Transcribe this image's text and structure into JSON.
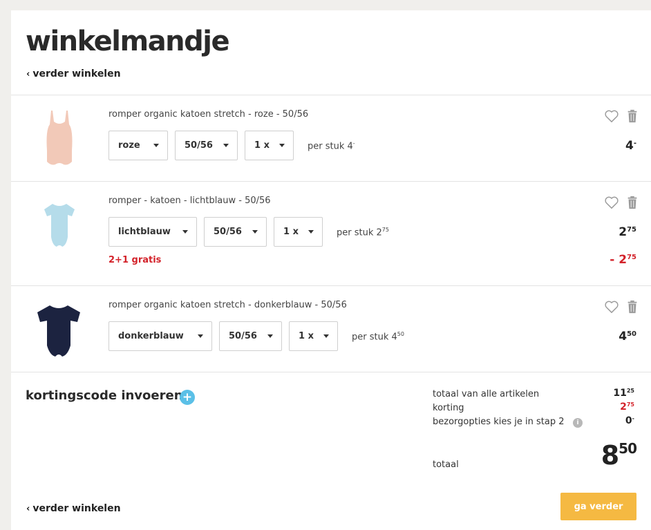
{
  "page": {
    "title": "winkelmandje",
    "back_link": "verder winkelen"
  },
  "cart": {
    "items": [
      {
        "name": "romper organic katoen stretch - roze - 50/56",
        "color": "roze",
        "size": "50/56",
        "qty": "1 x",
        "per_stuk_label": "per stuk",
        "unit_main": "4",
        "unit_dec": "-",
        "price_main": "4",
        "price_dec": "-",
        "image_color": "#f2c9b8"
      },
      {
        "name": "romper - katoen - lichtblauw - 50/56",
        "color": "lichtblauw",
        "size": "50/56",
        "qty": "1 x",
        "per_stuk_label": "per stuk",
        "unit_main": "2",
        "unit_dec": "75",
        "price_main": "2",
        "price_dec": "75",
        "promo": "2+1 gratis",
        "discount_main": "- 2",
        "discount_dec": "75",
        "image_color": "#b5dcea"
      },
      {
        "name": "romper organic katoen stretch - donkerblauw - 50/56",
        "color": "donkerblauw",
        "size": "50/56",
        "qty": "1 x",
        "per_stuk_label": "per stuk",
        "unit_main": "4",
        "unit_dec": "50",
        "price_main": "4",
        "price_dec": "50",
        "image_color": "#1c2340"
      }
    ]
  },
  "coupon": {
    "title": "kortingscode invoeren",
    "plus": "+"
  },
  "summary": {
    "lines": [
      {
        "label": "totaal van alle artikelen",
        "main": "11",
        "dec": "25"
      },
      {
        "label": "korting",
        "main": "2",
        "dec": "75"
      },
      {
        "label": "bezorgopties kies je in stap 2",
        "main": "0",
        "dec": "-"
      }
    ],
    "info": "i",
    "total_label": "totaal",
    "total_main": "8",
    "total_dec": "50"
  },
  "actions": {
    "continue_label": "ga verder"
  },
  "colors": {
    "accent": "#f5b942",
    "discount_red": "#d3222a",
    "info_blue": "#5bc0e7"
  }
}
